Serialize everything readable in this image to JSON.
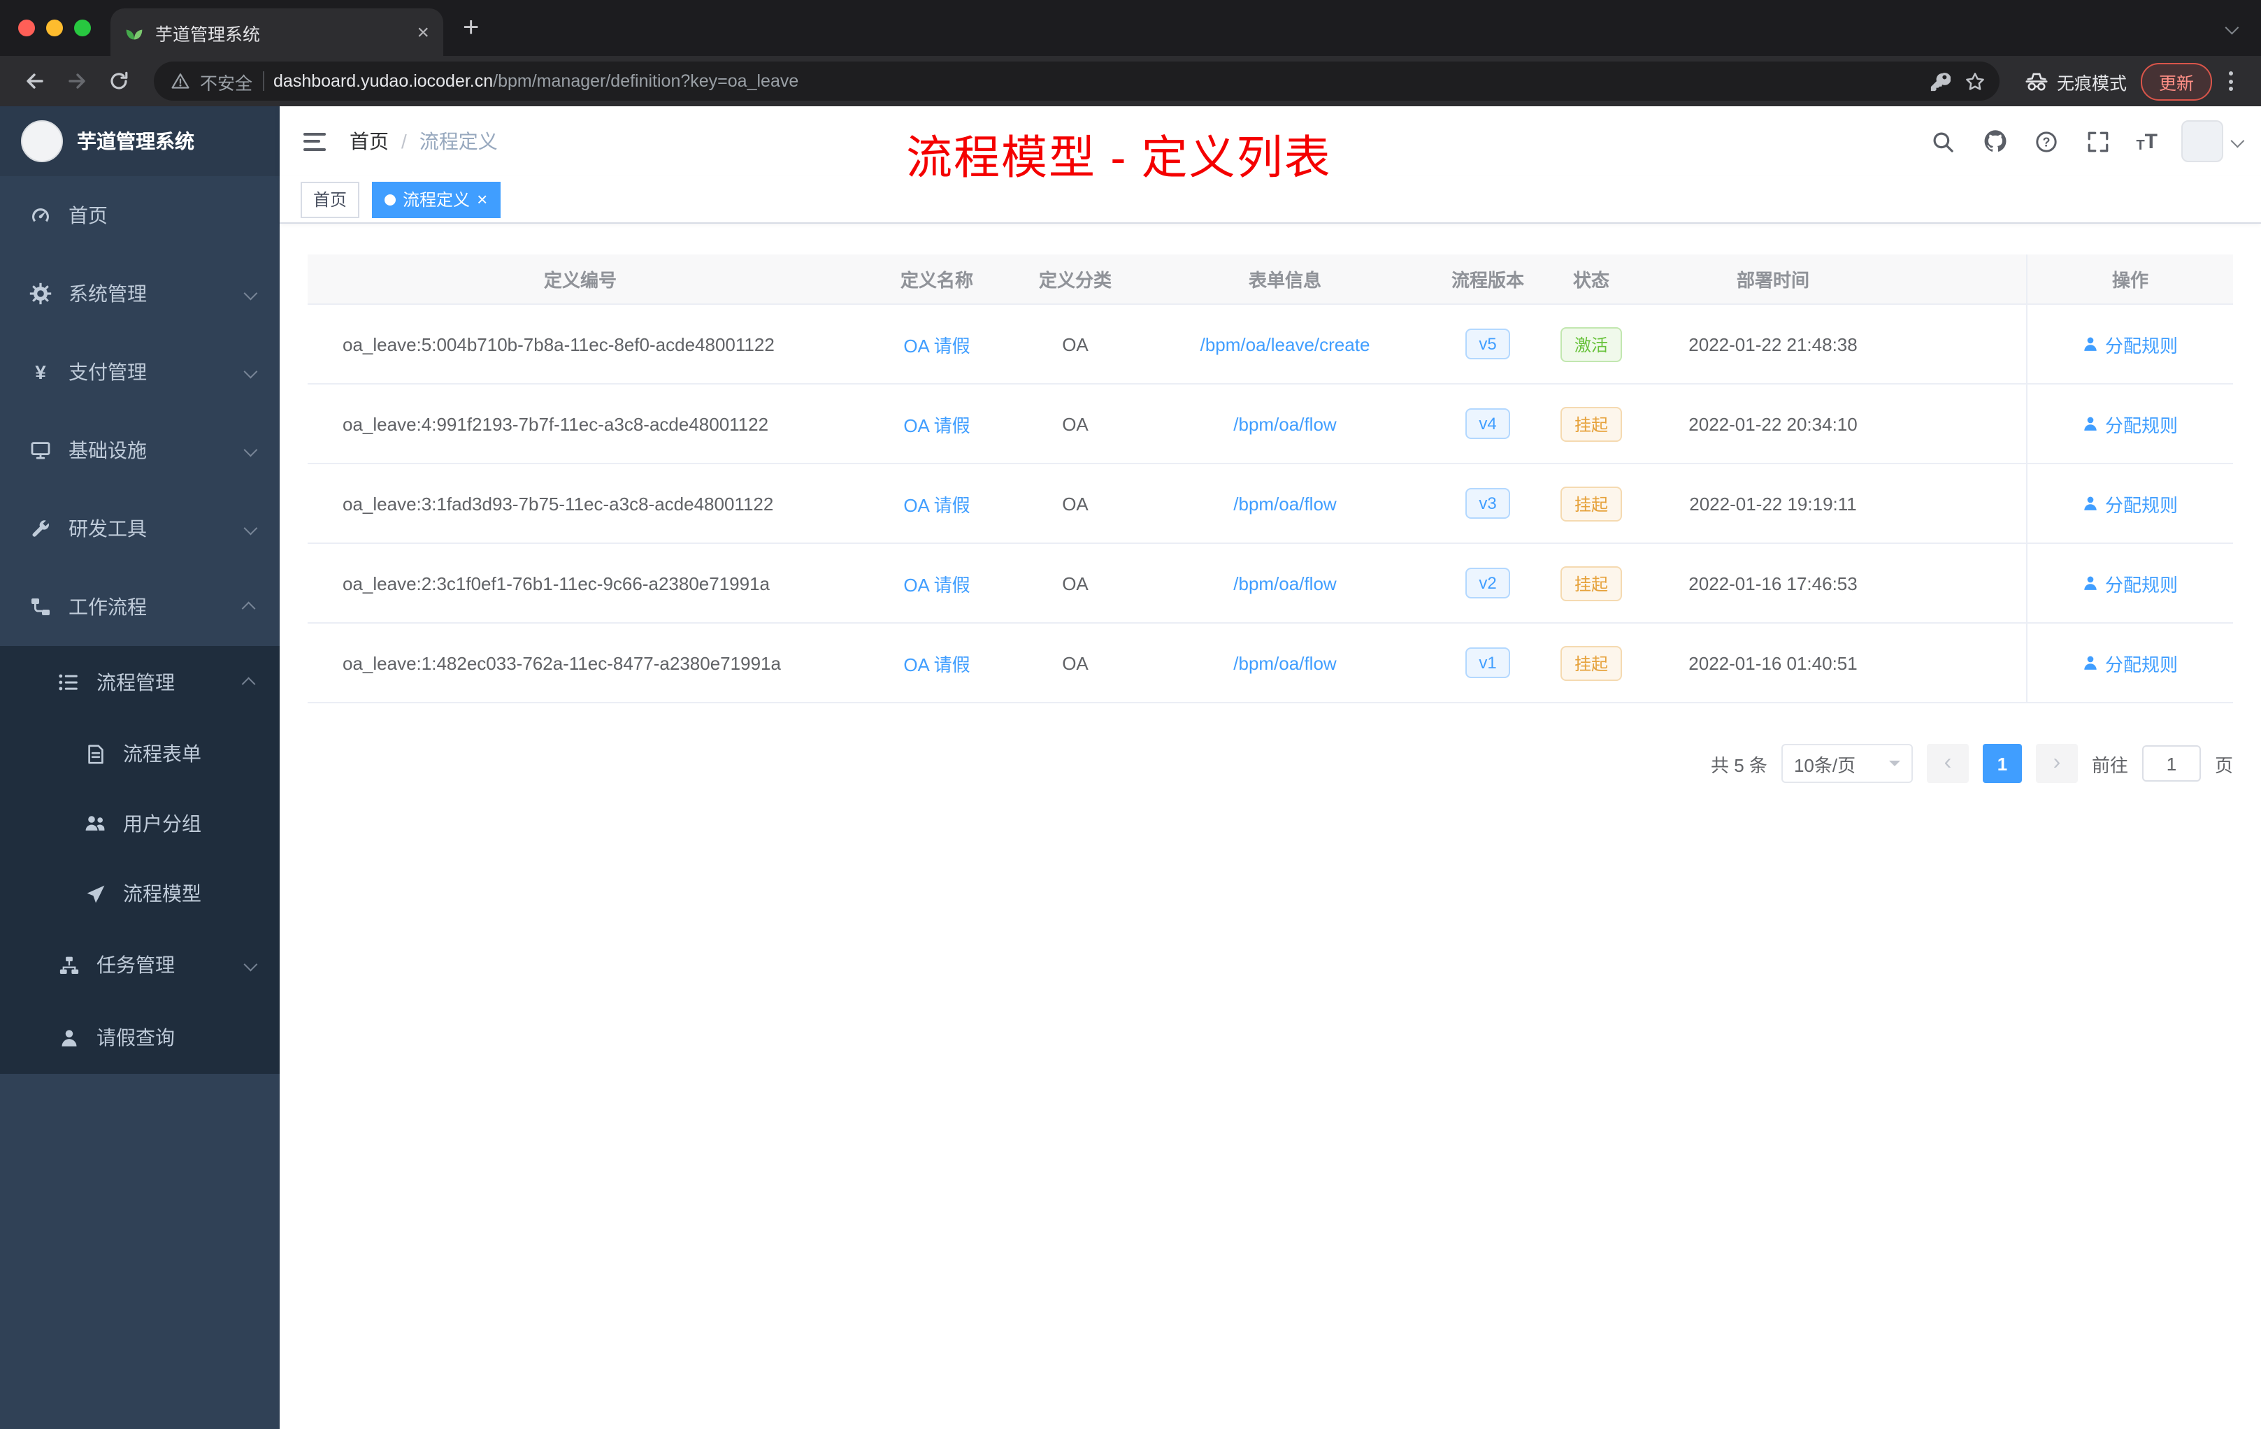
{
  "browser": {
    "tab": {
      "title": "芋道管理系统"
    },
    "address": {
      "security_label": "不安全",
      "domain": "dashboard.yudao.iocoder.cn",
      "path": "/bpm/manager/definition?key=oa_leave"
    },
    "incognito_label": "无痕模式",
    "update_label": "更新"
  },
  "icons": {
    "close": "×",
    "new_tab": "+",
    "yen": "¥",
    "prev": "‹",
    "next": "›",
    "font_small": "T",
    "font_big": "T"
  },
  "sidebar": {
    "logo_title": "芋道管理系统",
    "menu": [
      {
        "label": "首页",
        "icon": "dashboard-icon"
      },
      {
        "label": "系统管理",
        "icon": "gear-icon"
      },
      {
        "label": "支付管理",
        "icon": "yen-icon"
      },
      {
        "label": "基础设施",
        "icon": "monitor-icon"
      },
      {
        "label": "研发工具",
        "icon": "wrench-icon"
      },
      {
        "label": "工作流程",
        "icon": "workflow-icon"
      }
    ],
    "workflow_children": {
      "process_mgmt": {
        "label": "流程管理",
        "icon": "list-icon"
      },
      "process_children": [
        {
          "label": "流程表单",
          "icon": "form-icon"
        },
        {
          "label": "用户分组",
          "icon": "group-icon"
        },
        {
          "label": "流程模型",
          "icon": "send-icon"
        }
      ],
      "task_mgmt": {
        "label": "任务管理",
        "icon": "tree-icon"
      },
      "leave_query": {
        "label": "请假查询",
        "icon": "person-icon"
      }
    }
  },
  "header": {
    "breadcrumb": [
      "首页",
      "流程定义"
    ],
    "annotation": "流程模型 - 定义列表"
  },
  "tags": [
    {
      "label": "首页",
      "active": false
    },
    {
      "label": "流程定义",
      "active": true
    }
  ],
  "table": {
    "columns": [
      "定义编号",
      "定义名称",
      "定义分类",
      "表单信息",
      "流程版本",
      "状态",
      "部署时间",
      "操作"
    ],
    "rows": [
      {
        "id": "oa_leave:5:004b710b-7b8a-11ec-8ef0-acde48001122",
        "name": "OA 请假",
        "category": "OA",
        "form": "/bpm/oa/leave/create",
        "version": "v5",
        "status": "激活",
        "status_type": "success",
        "deployed": "2022-01-22 21:48:38",
        "action": "分配规则"
      },
      {
        "id": "oa_leave:4:991f2193-7b7f-11ec-a3c8-acde48001122",
        "name": "OA 请假",
        "category": "OA",
        "form": "/bpm/oa/flow",
        "version": "v4",
        "status": "挂起",
        "status_type": "warning",
        "deployed": "2022-01-22 20:34:10",
        "action": "分配规则"
      },
      {
        "id": "oa_leave:3:1fad3d93-7b75-11ec-a3c8-acde48001122",
        "name": "OA 请假",
        "category": "OA",
        "form": "/bpm/oa/flow",
        "version": "v3",
        "status": "挂起",
        "status_type": "warning",
        "deployed": "2022-01-22 19:19:11",
        "action": "分配规则"
      },
      {
        "id": "oa_leave:2:3c1f0ef1-76b1-11ec-9c66-a2380e71991a",
        "name": "OA 请假",
        "category": "OA",
        "form": "/bpm/oa/flow",
        "version": "v2",
        "status": "挂起",
        "status_type": "warning",
        "deployed": "2022-01-16 17:46:53",
        "action": "分配规则"
      },
      {
        "id": "oa_leave:1:482ec033-762a-11ec-8477-a2380e71991a",
        "name": "OA 请假",
        "category": "OA",
        "form": "/bpm/oa/flow",
        "version": "v1",
        "status": "挂起",
        "status_type": "warning",
        "deployed": "2022-01-16 01:40:51",
        "action": "分配规则"
      }
    ]
  },
  "pagination": {
    "total": "共 5 条",
    "page_size": "10条/页",
    "current_page": "1",
    "goto_label": "前往",
    "goto_value": "1",
    "page_label": "页"
  },
  "colors": {
    "accent": "#409eff",
    "success": "#67c23a",
    "warning": "#e6a23c",
    "annotation": "#f40000",
    "sidebar_bg": "#304156",
    "submenu_bg": "#1f2d3d"
  }
}
